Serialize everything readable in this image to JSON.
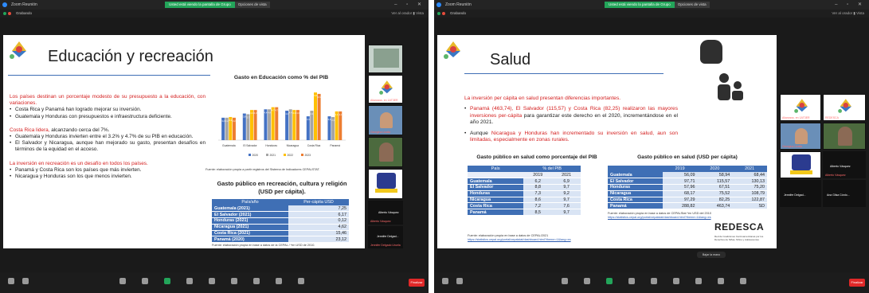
{
  "left": {
    "titlebar": {
      "app": "Zoom Reunión",
      "share_notice": "Usted está viendo la pantalla de Grupo",
      "view_options": "Opciones de vista"
    },
    "subbar": {
      "label": "Grabando",
      "right": "Ver al orador  ▮ Vista"
    },
    "slide": {
      "title": "Educación y recreación",
      "intro_red": "Los países destinan un porcentaje modesto de su presupuesto a la educación, con variaciones.",
      "bullets1": [
        "Costa Rica y Panamá han logrado mejorar su inversión.",
        "Guatemala y Honduras con presupuestos e infraestructura deficiente."
      ],
      "lead2_red": "Costa Rica lidera,",
      "lead2_rest": " alcanzando cerca del 7%.",
      "bullets2": [
        "Guatemala y Honduras invierten entre el 3.2% y 4.7% de su PIB en educación.",
        "El Salvador y Nicaragua, aunque han mejorado su gasto, presentan desafíos en términos de la equidad en el acceso."
      ],
      "lead3_red": "La inversión en recreación es un desafío en todos los países.",
      "bullets3": [
        "Panamá y Costa Rica son los países que más invierten.",
        "Nicaragua y Honduras son los que menos invierten."
      ],
      "chart_title": "Gasto en Educación como % del PIB",
      "chart_source": "Fuente: elaboración propia a partir registros del Sistema de Indicadores CEPALSTAT.",
      "table_title": "Gasto público en recreación, cultura y religión (USD  per cápita).",
      "table_headers": [
        "País/año",
        "Per-cápita USD"
      ],
      "table_rows": [
        [
          "Guatemala (2021)",
          "7,25"
        ],
        [
          "El Salvador (2021)",
          "6,17"
        ],
        [
          "Honduras (2021)",
          "0,12"
        ],
        [
          "Nicaragua (2021)",
          "4,62"
        ],
        [
          "Costa Rica (2021)",
          "15,46"
        ],
        [
          "Panamá (2020)",
          "23,12"
        ]
      ],
      "table_source": "Fuente: elaboración propia en base a datos de la CEPAL / *en USD de 2010."
    },
    "participants": [
      {
        "name": "",
        "label": ""
      },
      {
        "name": "",
        "label": "Aliancsss. en 1AT3ER"
      },
      {
        "name": "",
        "label": "Georgina Ucalla"
      },
      {
        "name": "",
        "label": ""
      },
      {
        "name": "Alberto Vásquez",
        "label": "Alberto Vásquez"
      },
      {
        "name": "Jennifer  Delgad...",
        "label": "Jennifer Delgado Uruela"
      }
    ],
    "toolbar": {
      "end": "Finalizar"
    }
  },
  "right": {
    "titlebar": {
      "app": "Zoom Reunión",
      "share_notice": "Usted está viendo la pantalla de Grupo",
      "view_options": "Opciones de vista"
    },
    "subbar": {
      "label": "Grabando",
      "right": "Ver al orador  ▮ Vista"
    },
    "slide": {
      "title": "Salud",
      "intro_red": "La inversión per cápita en salud presentan diferencias importantes.",
      "b1_red": "Panamá (463,74), El Salvador (115,57) y Costa Rica (82,25) realizaron las mayores inversiones per-cápita",
      "b1_rest": " para garantizar este derecho en el 2020, incrementándose en el año 2021.",
      "b2_black": "Aunque ",
      "b2_red": "Nicaragua y Honduras han incrementado su inversión en salud, aun son limitadas, especialmente en zonas rurales.",
      "t1_title": "Gasto público en salud como porcentaje del PIB",
      "t1_headers": [
        "País",
        "% del PIB"
      ],
      "t1_years": [
        "2019",
        "2021"
      ],
      "t1_rows": [
        [
          "Guatemala",
          "6,2",
          "6,9"
        ],
        [
          "El Salvador",
          "8,8",
          "9,7"
        ],
        [
          "Honduras",
          "7,3",
          "9,2"
        ],
        [
          "Nicaragua",
          "8,6",
          "9,7"
        ],
        [
          "Costa Rica",
          "7,2",
          "7,6"
        ],
        [
          "Panamá",
          "8,5",
          "9,7"
        ]
      ],
      "t2_title": "Gasto público en salud (USD per cápita)",
      "t2_years": [
        "2019",
        "2020",
        "2021"
      ],
      "t2_rows": [
        [
          "Guatemala",
          "56,09",
          "58,94",
          "68,44"
        ],
        [
          "El Salvador",
          "97,71",
          "115,57",
          "130,13"
        ],
        [
          "Honduras",
          "57,96",
          "67,51",
          "75,20"
        ],
        [
          "Nicaragua",
          "68,17",
          "75,52",
          "108,79"
        ],
        [
          "Costa Rica",
          "97,29",
          "82,25",
          "122,87"
        ],
        [
          "Panamá",
          "288,82",
          "463,74",
          "SD"
        ]
      ],
      "t1_source": "Fuente: elaboración propia en base a datos de CEPAL/2021",
      "t1_link": "https://statistics.cepal.org/portal/cepalstat/dashboard.html?theme=1&lang=es",
      "t2_source": "Fuente: elaboración propia en base a datos de CEPALStat *en USD del 2010",
      "t2_link": "https://statistics.cepal.org/portal/cepalstat/dashboard.html?theme=1&lang=es",
      "logo": "REDESCA",
      "logo_sub": "Red de Coaliciones Centroamericanas por los Derechos de Niñas, Niños y Adolescentes"
    },
    "participants": [
      {
        "label": "Aliancsss. en 1AT3ER"
      },
      {
        "label": "REDESCA"
      },
      {
        "label": "Georgina Ucalla"
      },
      {
        "label": ""
      },
      {
        "label": "Alberto Vásquez"
      },
      {
        "label": "Alberto Vásquez"
      },
      {
        "label": "Jennifer  Delgad..."
      },
      {
        "label": "Ana Gilsa Córdo..."
      }
    ],
    "raise_hand": "Bajar la mano",
    "toolbar": {
      "end": "Finalizar"
    }
  },
  "chart_data": {
    "type": "bar",
    "title": "Gasto en Educación como % del PIB",
    "categories": [
      "Guatemala",
      "El Salvador",
      "Honduras",
      "Nicaragua",
      "Costa Rica",
      "Panamá"
    ],
    "series": [
      {
        "name": "2020",
        "color": "#4472c4",
        "values": [
          3.2,
          3.8,
          4.4,
          4.2,
          3.4,
          3.4
        ]
      },
      {
        "name": "2021",
        "color": "#a5a5a5",
        "values": [
          3.2,
          3.7,
          4.4,
          4.4,
          4.2,
          3.3
        ]
      },
      {
        "name": "2022",
        "color": "#ffc000",
        "values": [
          3.3,
          4.3,
          4.7,
          4.3,
          6.8,
          4.1
        ]
      },
      {
        "name": "2023",
        "color": "#ed7d31",
        "values": [
          3.2,
          4.3,
          4.7,
          4.3,
          6.6,
          4.1
        ]
      }
    ],
    "legend": "bottom"
  }
}
